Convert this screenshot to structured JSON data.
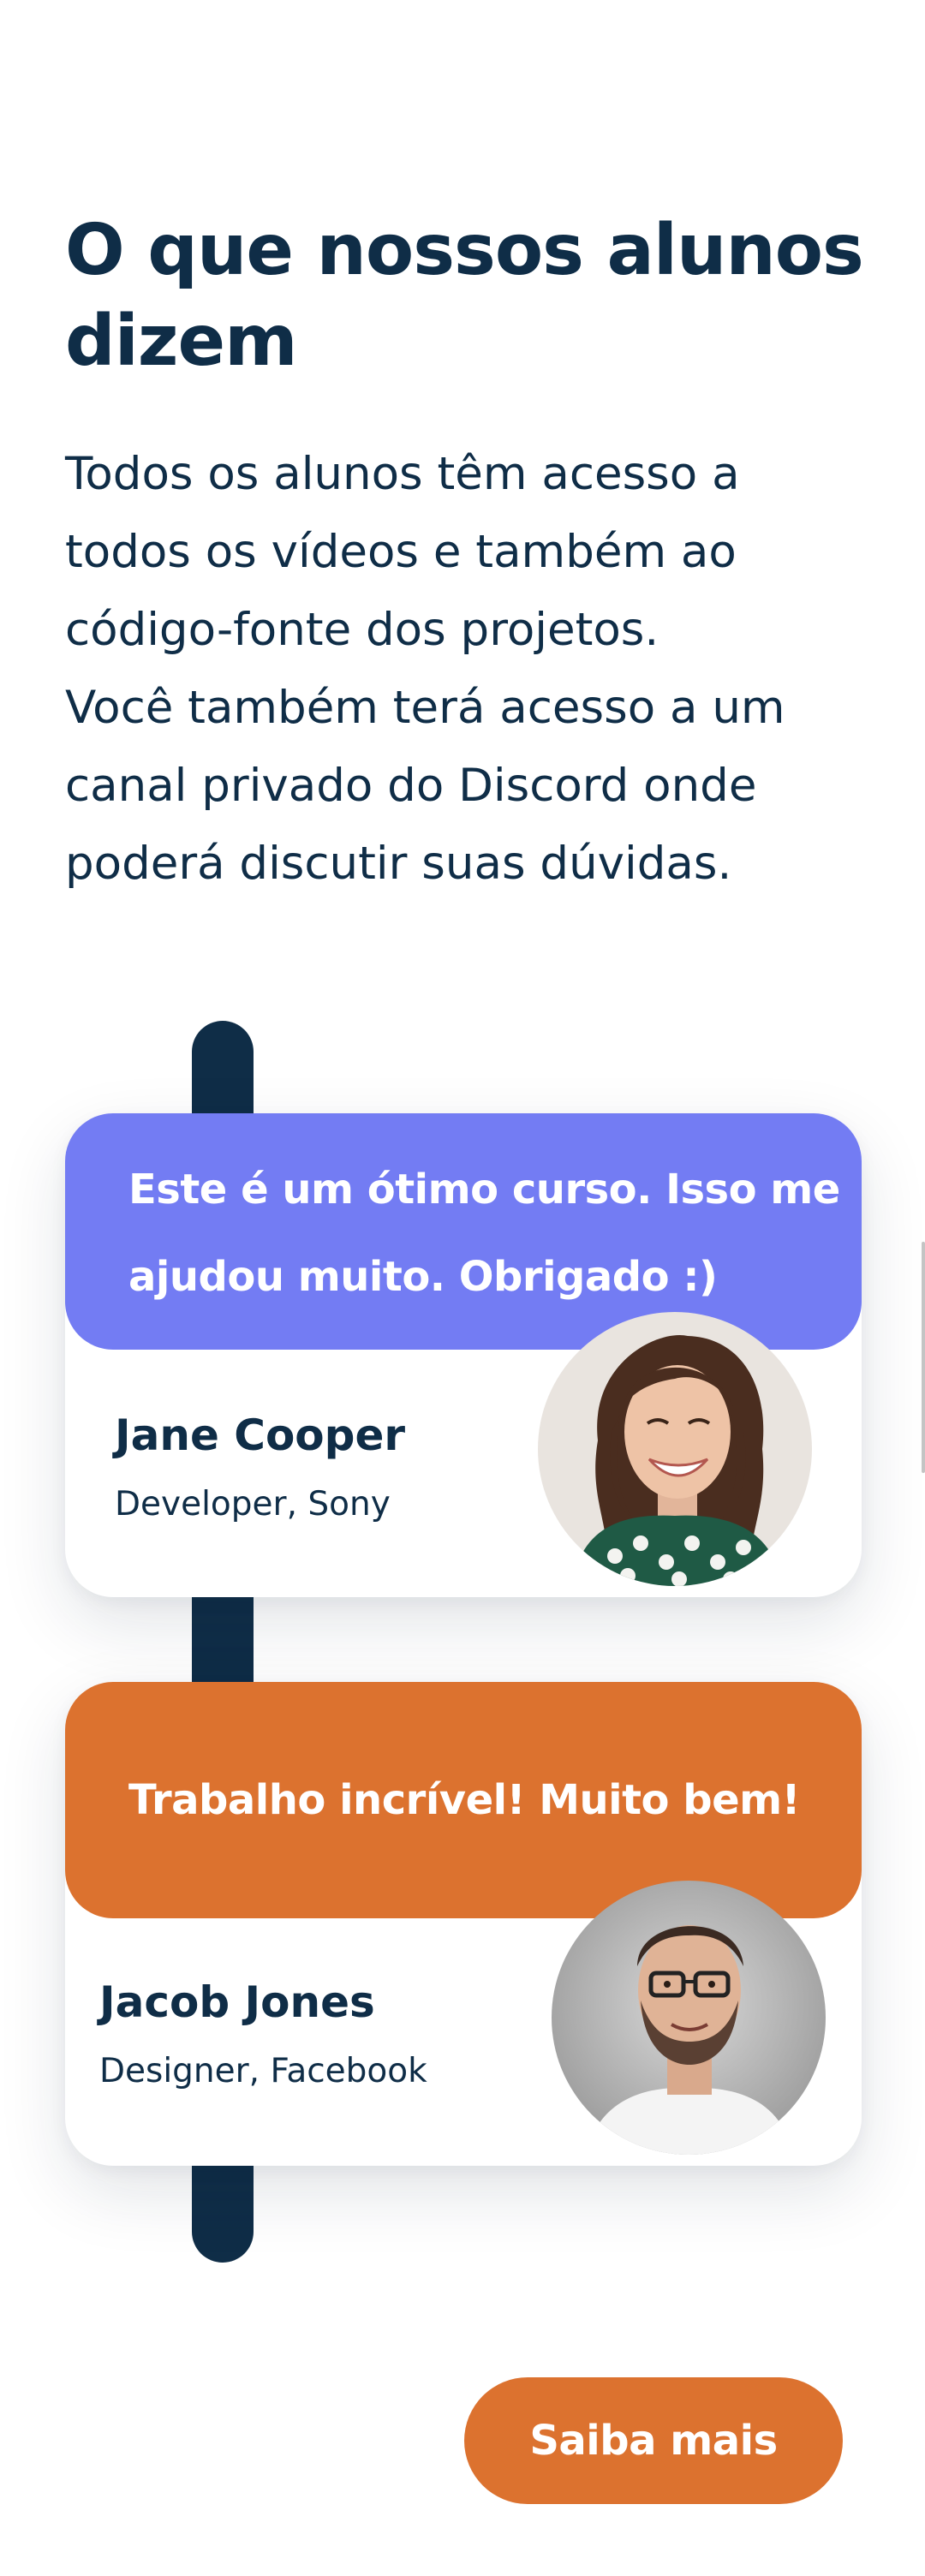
{
  "section": {
    "title": "O que nossos alunos dizem",
    "intro_lines": [
      "Todos os alunos têm acesso a",
      "todos os vídeos e também ao",
      "código-fonte dos projetos.",
      "Você também terá acesso a um",
      "canal privado do Discord onde",
      "poderá discutir suas dúvidas."
    ]
  },
  "testimonials": [
    {
      "quote_lines": [
        "Este é um ótimo curso. Isso me",
        "ajudou muito. Obrigado :)"
      ],
      "name": "Jane Cooper",
      "role": "Developer, Sony",
      "avatar": "jane-cooper-photo",
      "bubble_color": "#737cf3"
    },
    {
      "quote_lines": [
        "Trabalho incrível! Muito bem!"
      ],
      "name": "Jacob Jones",
      "role": "Designer, Facebook",
      "avatar": "jacob-jones-photo",
      "bubble_color": "#dc722f"
    }
  ],
  "cta": {
    "label": "Saiba mais",
    "color": "#dc722f"
  },
  "theme": {
    "text_color": "#0f2d47",
    "timeline_color": "#0f2d47"
  }
}
